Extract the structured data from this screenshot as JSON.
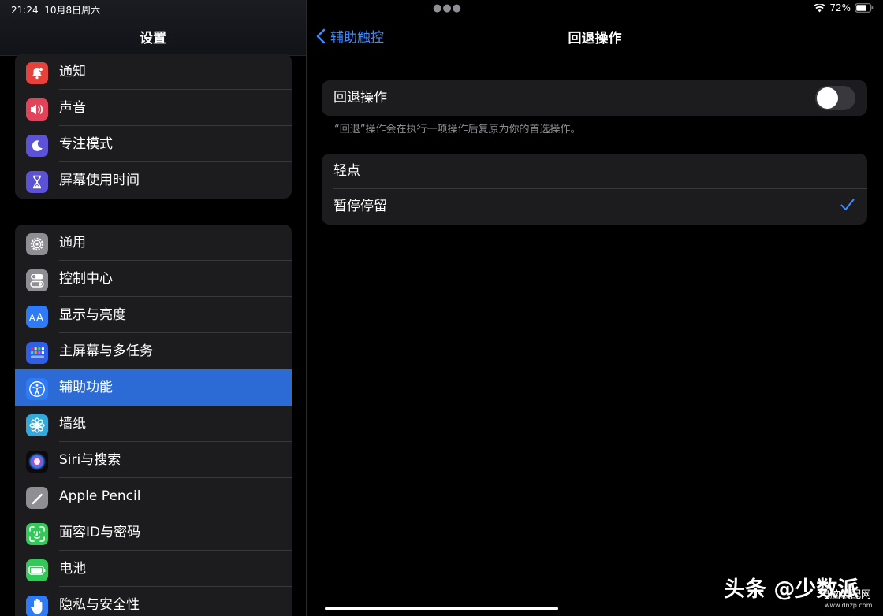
{
  "status": {
    "time": "21:24",
    "date": "10月8日周六",
    "battery": "72%"
  },
  "sidebar": {
    "title": "设置",
    "group1": [
      {
        "label": "通知",
        "icon": "bell-icon",
        "color": "#e5423b"
      },
      {
        "label": "声音",
        "icon": "speaker-icon",
        "color": "#e0435a"
      },
      {
        "label": "专注模式",
        "icon": "moon-icon",
        "color": "#5b52d6"
      },
      {
        "label": "屏幕使用时间",
        "icon": "hourglass-icon",
        "color": "#5b52d6"
      }
    ],
    "group2": [
      {
        "label": "通用",
        "icon": "gear-icon",
        "color": "#8e8e93"
      },
      {
        "label": "控制中心",
        "icon": "toggles-icon",
        "color": "#8e8e93"
      },
      {
        "label": "显示与亮度",
        "icon": "text-size-icon",
        "color": "#2f7bf6"
      },
      {
        "label": "主屏幕与多任务",
        "icon": "home-grid-icon",
        "color": "#2f5fe6"
      },
      {
        "label": "辅助功能",
        "icon": "accessibility-icon",
        "color": "#2f7bf6",
        "selected": true
      },
      {
        "label": "墙纸",
        "icon": "flower-icon",
        "color": "#34aadc"
      },
      {
        "label": "Siri与搜索",
        "icon": "siri-icon",
        "color": "#1c1c1e"
      },
      {
        "label": "Apple Pencil",
        "icon": "pencil-icon",
        "color": "#8e8e93"
      },
      {
        "label": "面容ID与密码",
        "icon": "face-id-icon",
        "color": "#34c759"
      },
      {
        "label": "电池",
        "icon": "battery-icon",
        "color": "#34c759"
      },
      {
        "label": "隐私与安全性",
        "icon": "hand-icon",
        "color": "#2f7bf6"
      }
    ]
  },
  "detail": {
    "back_label": "辅助触控",
    "title": "回退操作",
    "toggle_label": "回退操作",
    "toggle_on": false,
    "footnote": "“回退”操作会在执行一项操作后复原为你的首选操作。",
    "options": [
      {
        "label": "轻点",
        "checked": false
      },
      {
        "label": "暂停停留",
        "checked": true
      }
    ],
    "accent": "#3d8bff"
  },
  "watermark": {
    "main": "头条 @少数派",
    "site": "电脑装配网",
    "url": "www.dnzp.com"
  }
}
